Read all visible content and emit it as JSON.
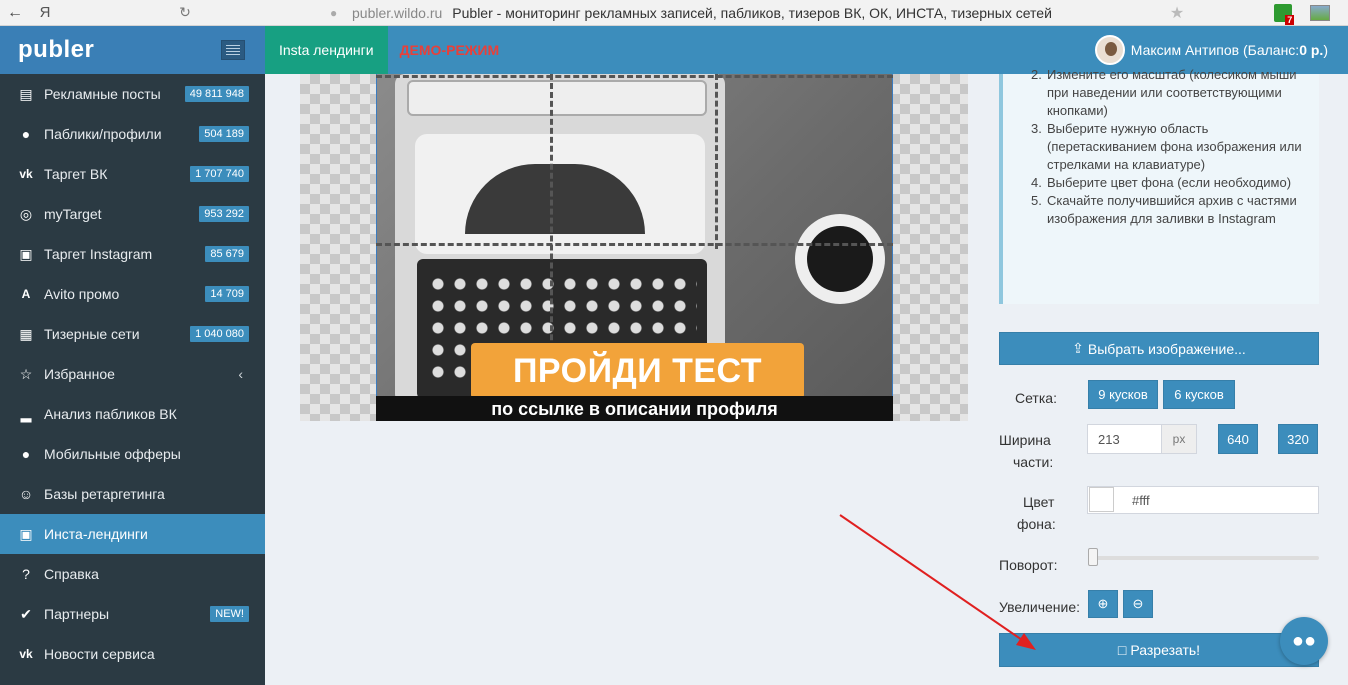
{
  "browser": {
    "back": "←",
    "yandex": "Я",
    "reload": "↻",
    "url": "publer.wildo.ru",
    "title": "Publer - мониторинг рекламных записей, пабликов, тизеров ВК, ОК, ИНСТА, тизерных сетей",
    "ext_badge": "7"
  },
  "app": {
    "logo": "publer"
  },
  "sidebar": {
    "items": [
      {
        "label": "Рекламные посты",
        "badge": "49 811 948",
        "icon": "newspaper-icon"
      },
      {
        "label": "Паблики/профили",
        "badge": "504 189",
        "icon": "comments-icon"
      },
      {
        "label": "Таргет ВК",
        "badge": "1 707 740",
        "icon": "vk-icon"
      },
      {
        "label": "myTarget",
        "badge": "953 292",
        "icon": "target-icon"
      },
      {
        "label": "Таргет Instagram",
        "badge": "85 679",
        "icon": "instagram-icon"
      },
      {
        "label": "Avito промо",
        "badge": "14 709",
        "icon": "avito-icon"
      },
      {
        "label": "Тизерные сети",
        "badge": "1 040 080",
        "icon": "table-icon"
      },
      {
        "label": "Избранное",
        "chevron": "‹",
        "icon": "star-icon"
      },
      {
        "label": "Анализ пабликов ВК",
        "icon": "chart-icon"
      },
      {
        "label": "Мобильные офферы",
        "icon": "gamepad-icon"
      },
      {
        "label": "Базы ретаргетинга",
        "icon": "users-icon"
      },
      {
        "label": "Инста-лендинги",
        "icon": "instagram-icon",
        "active": true
      },
      {
        "label": "Справка",
        "icon": "question-icon"
      },
      {
        "label": "Партнеры",
        "badge": "NEW!",
        "icon": "check-icon"
      },
      {
        "label": "Новости сервиса",
        "icon": "vk-icon"
      }
    ]
  },
  "topbar": {
    "tab": "Insta лендинги",
    "demo": "ДЕМО-РЕЖИМ",
    "user_name": "Максим Антипов",
    "balance_prefix": "(Баланс: ",
    "balance_value": "0 р.",
    "balance_suffix": ")"
  },
  "image": {
    "headline": "ПРОЙДИ ТЕСТ",
    "caption": "по ссылке в описании профиля"
  },
  "instructions": [
    {
      "n": "2.",
      "text": "Измените его масштаб (колесиком мыши при наведении или соответствующими кнопками)"
    },
    {
      "n": "3.",
      "text": "Выберите нужную область (перетаскиванием фона изображения или стрелками на клавиатуре)"
    },
    {
      "n": "4.",
      "text": "Выберите цвет фона (если необходимо)"
    },
    {
      "n": "5.",
      "text": "Скачайте получившийся архив с частями изображения для заливки в Instagram"
    }
  ],
  "controls": {
    "choose_image": "Выбрать изображение...",
    "grid_label": "Сетка:",
    "grid_9": "9 кусков",
    "grid_6": "6 кусков",
    "width_label_1": "Ширина",
    "width_label_2": "части:",
    "width_value": "213",
    "width_unit": "px",
    "width_640": "640",
    "width_320": "320",
    "bg_label_1": "Цвет",
    "bg_label_2": "фона:",
    "bg_value": "#fff",
    "rotate_label": "Поворот:",
    "rotate_value": 0,
    "zoom_label": "Увеличение:",
    "cut_button": "Разрезать!"
  },
  "colors": {
    "primary": "#3c8dbc",
    "sidebar": "#2b3a43",
    "accent_tab": "#17a082",
    "demo": "#e8403a",
    "orange": "#f2a33a",
    "arrow": "#e02020"
  }
}
